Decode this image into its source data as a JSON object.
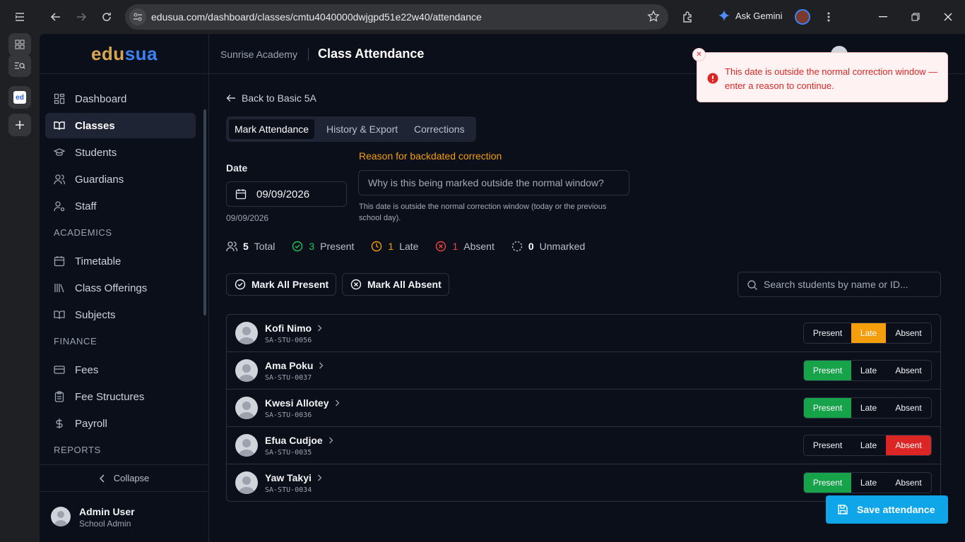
{
  "browser": {
    "url": "edusua.com/dashboard/classes/cmtu4040000dwjgpd51e22w40/attendance",
    "gemini_label": "Ask Gemini",
    "tab_favicon_text": "ed"
  },
  "sidebar": {
    "logo_part1": "edu",
    "logo_part2": "sua",
    "items": [
      {
        "label": "Dashboard",
        "icon": "grid-icon"
      },
      {
        "label": "Classes",
        "icon": "book-open-icon",
        "active": true
      },
      {
        "label": "Students",
        "icon": "graduation-cap-icon"
      },
      {
        "label": "Guardians",
        "icon": "users-icon"
      },
      {
        "label": "Staff",
        "icon": "user-cog-icon"
      }
    ],
    "section_academics": "ACADEMICS",
    "academics_items": [
      {
        "label": "Timetable",
        "icon": "calendar-icon"
      },
      {
        "label": "Class Offerings",
        "icon": "library-icon"
      },
      {
        "label": "Subjects",
        "icon": "book-icon"
      }
    ],
    "section_finance": "FINANCE",
    "finance_items": [
      {
        "label": "Fees",
        "icon": "credit-card-icon"
      },
      {
        "label": "Fee Structures",
        "icon": "clipboard-icon"
      },
      {
        "label": "Payroll",
        "icon": "dollar-icon"
      }
    ],
    "section_reports": "REPORTS",
    "collapse_label": "Collapse",
    "user_name": "Admin User",
    "user_role": "School Admin"
  },
  "header": {
    "school": "Sunrise Academy",
    "title": "Class Attendance"
  },
  "main": {
    "back_label": "Back to Basic 5A",
    "tabs": [
      "Mark Attendance",
      "History & Export",
      "Corrections"
    ],
    "date_label": "Date",
    "date_value": "09/09/2026",
    "date_sub": "09/09/2026",
    "reason_label": "Reason for backdated correction",
    "reason_placeholder": "Why is this being marked outside the normal window?",
    "reason_help": "This date is outside the normal correction window (today or the previous school day).",
    "stats": {
      "total": "5",
      "total_label": "Total",
      "present": "3",
      "present_label": "Present",
      "late": "1",
      "late_label": "Late",
      "absent": "1",
      "absent_label": "Absent",
      "unmarked": "0",
      "unmarked_label": "Unmarked"
    },
    "mark_all_present": "Mark All Present",
    "mark_all_absent": "Mark All Absent",
    "search_placeholder": "Search students by name or ID...",
    "status_labels": {
      "present": "Present",
      "late": "Late",
      "absent": "Absent"
    },
    "students": [
      {
        "name": "Kofi Nimo",
        "id": "SA-STU-0056",
        "status": "late"
      },
      {
        "name": "Ama Poku",
        "id": "SA-STU-0037",
        "status": "present"
      },
      {
        "name": "Kwesi Allotey",
        "id": "SA-STU-0036",
        "status": "present"
      },
      {
        "name": "Efua Cudjoe",
        "id": "SA-STU-0035",
        "status": "absent"
      },
      {
        "name": "Yaw Takyi",
        "id": "SA-STU-0034",
        "status": "present"
      }
    ],
    "save_label": "Save attendance"
  },
  "toast": {
    "message": "This date is outside the normal correction window — enter a reason to continue."
  },
  "colors": {
    "accent": "#0ea5e9",
    "present": "#16a34a",
    "late": "#f59e0b",
    "absent": "#dc2626",
    "toast_bg": "#fef2f2",
    "toast_text": "#dc2626"
  }
}
